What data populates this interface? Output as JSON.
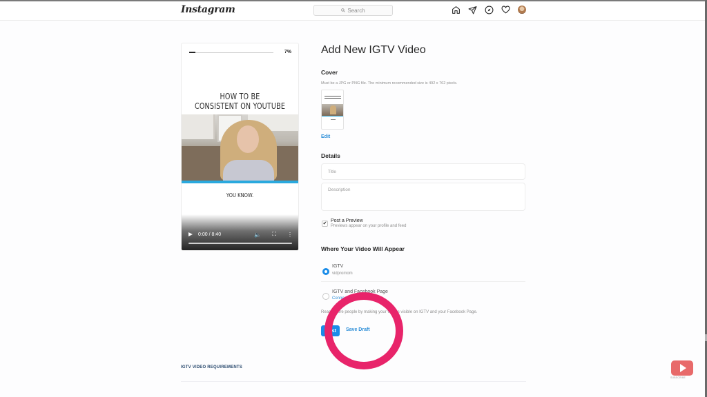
{
  "app": {
    "logo": "Instagram",
    "search_placeholder": "Search",
    "nav_icons": [
      "home-icon",
      "direct-icon",
      "explore-icon",
      "activity-heart-icon",
      "profile-avatar"
    ]
  },
  "preview": {
    "progress_percent": 7,
    "progress_label": "7%",
    "headline_line1": "HOW TO BE",
    "headline_line2": "CONSISTENT ON YOUTUBE",
    "caption": "YOU KNOW.",
    "time": "0:00 / 8:40",
    "controls": [
      "play-icon",
      "volume-icon",
      "fullscreen-icon",
      "more-icon"
    ]
  },
  "form": {
    "title": "Add New IGTV Video",
    "cover": {
      "heading": "Cover",
      "hint": "Must be a JPG or PNG file. The minimum recommended size is 492 x 762 pixels.",
      "edit_label": "Edit"
    },
    "details": {
      "heading": "Details",
      "title_placeholder": "Title",
      "description_placeholder": "Description",
      "title_value": "",
      "description_value": ""
    },
    "post_preview": {
      "checked": true,
      "label": "Post a Preview",
      "sublabel": "Previews appear on your profile and feed"
    },
    "placement": {
      "heading": "Where Your Video Will Appear",
      "options": [
        {
          "label": "IGTV",
          "sublabel": "vidpromom",
          "selected": true
        },
        {
          "label": "IGTV and Facebook Page",
          "sublabel": "Connect Page",
          "selected": false
        }
      ],
      "reach_text": "Reach more people by making your videos visible on IGTV and your Facebook Page."
    },
    "post_label": "Post",
    "save_draft_label": "Save Draft"
  },
  "footer": {
    "requirements_label": "IGTV VIDEO REQUIREMENTS"
  },
  "overlay": {
    "subscribe_label": "SUBSCRIBE",
    "annotation_color": "#e8246a"
  },
  "colors": {
    "accent": "#1a8ce8",
    "link": "#2e8fd8",
    "video_bar": "#2aa9de"
  }
}
